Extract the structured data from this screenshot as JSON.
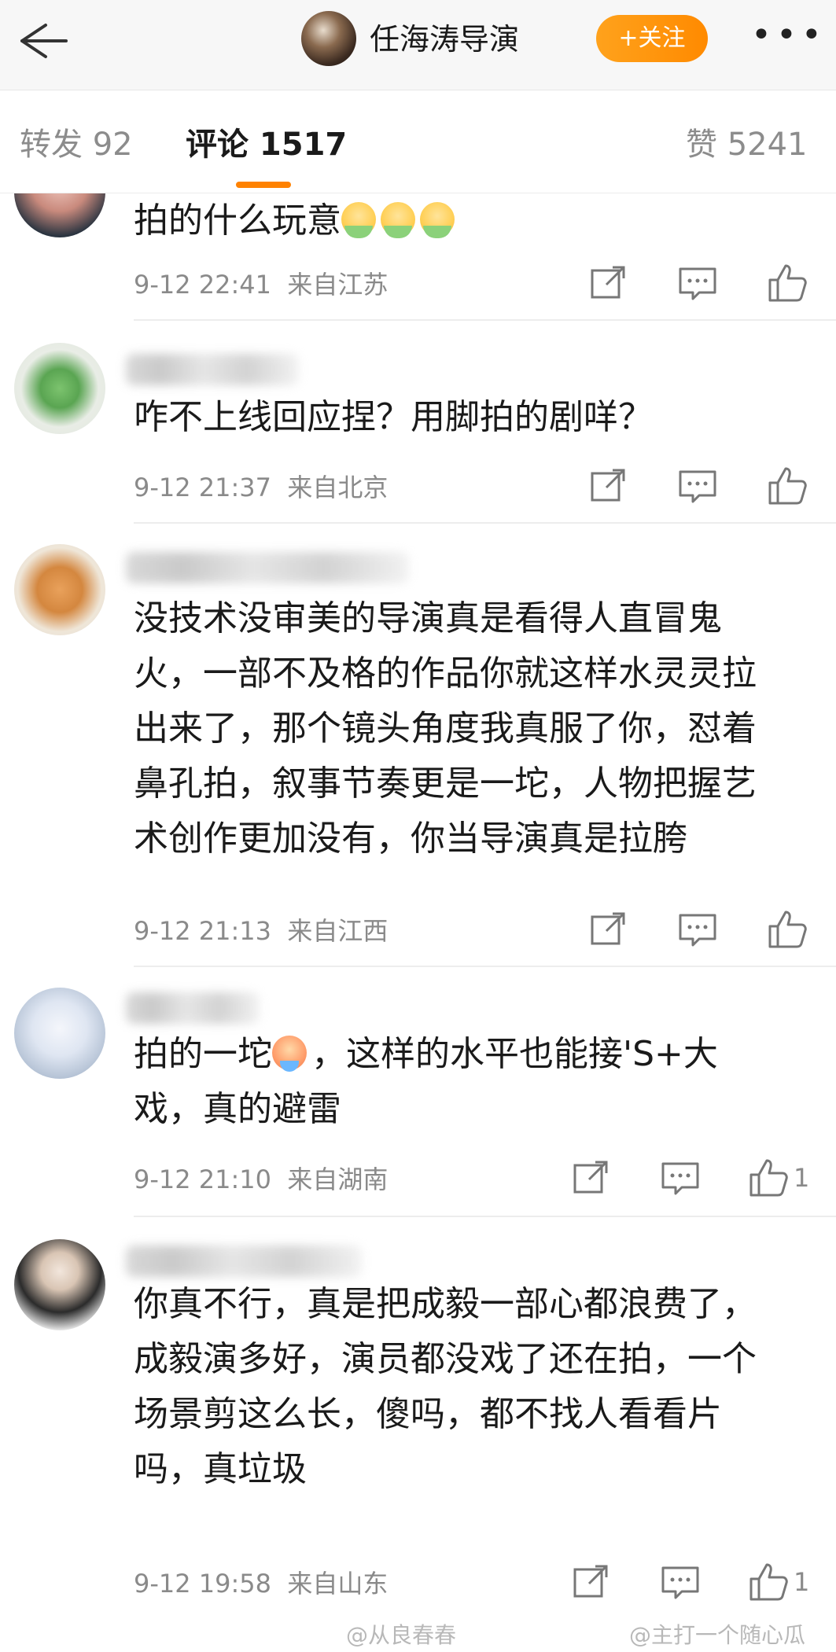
{
  "header": {
    "back_icon": "back-arrow-icon",
    "profile_name": "任海涛导演",
    "follow_label": "+关注",
    "more_icon": "more-dots-icon",
    "more_label": "•••"
  },
  "tabs": {
    "repost": "转发 92",
    "comments": "评论 1517",
    "likes": "赞 5241",
    "accent_color": "#ff8200"
  },
  "comments": [
    {
      "text": "拍的什么玩意",
      "emoji_count": 3,
      "time": "9-12 22:41",
      "location": "来自江苏",
      "likes": ""
    },
    {
      "text": "咋不上线回应捏？用脚拍的剧咩？",
      "time": "9-12 21:37",
      "location": "来自北京",
      "likes": ""
    },
    {
      "text": "没技术没审美的导演真是看得人直冒鬼火，一部不及格的作品你就这样水灵灵拉出来了，那个镜头角度我真服了你，怼着鼻孔拍，叙事节奏更是一坨，人物把握艺术创作更加没有，你当导演真是拉胯",
      "time": "9-12 21:13",
      "location": "来自江西",
      "likes": ""
    },
    {
      "text_before": "拍的一坨",
      "text_after": "，这样的水平也能接'S+大戏，真的避雷",
      "time": "9-12 21:10",
      "location": "来自湖南",
      "likes": "1"
    },
    {
      "text": "你真不行，真是把成毅一部心都浪费了，成毅演多好，演员都没戏了还在拍，一个场景剪这么长，傻吗，都不找人看看片吗，真垃圾",
      "time": "9-12 19:58",
      "location": "来自山东",
      "likes": "1"
    }
  ],
  "watermarks": {
    "left": "@从良春春",
    "right": "@主打一个随心瓜"
  }
}
